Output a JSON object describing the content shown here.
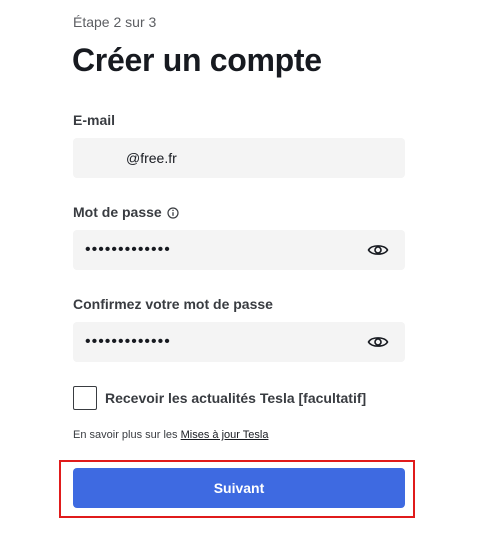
{
  "header": {
    "step": "Étape 2 sur 3",
    "title": "Créer un compte"
  },
  "form": {
    "email": {
      "label": "E-mail",
      "value": "@free.fr"
    },
    "password": {
      "label": "Mot de passe",
      "value": "•••••••••••••"
    },
    "confirm_password": {
      "label": "Confirmez votre mot de passe",
      "value": "•••••••••••••"
    },
    "newsletter": {
      "label": "Recevoir les actualités Tesla [facultatif]",
      "checked": false
    },
    "learn_more": {
      "prefix": "En savoir plus sur les ",
      "link": "Mises à jour Tesla"
    },
    "next_button": "Suivant"
  },
  "colors": {
    "primary_button": "#3e6ae1",
    "highlight_border": "#e01b1b",
    "field_background": "#f4f4f4"
  },
  "icons": {
    "password_info": "info-icon",
    "password_toggle": "eye-icon",
    "confirm_toggle": "eye-icon"
  }
}
